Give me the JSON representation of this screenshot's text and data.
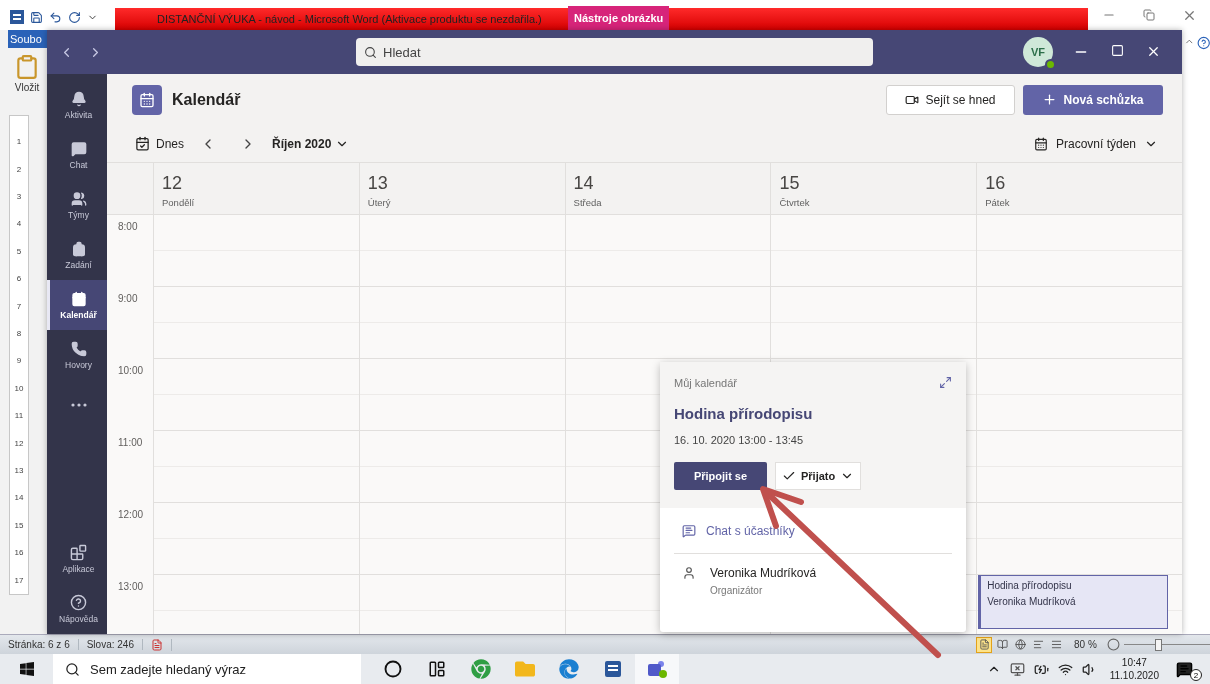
{
  "word": {
    "title": "DISTANČNÍ VÝUKA - návod  -  Microsoft Word (Aktivace produktu se nezdařila.)",
    "context_tab": "Nástroje obrázku",
    "file_tab": "Soubo",
    "paste_label": "Vložit",
    "ruler_numbers": [
      "1",
      "2",
      "3",
      "4",
      "5",
      "6",
      "7",
      "8",
      "9",
      "10",
      "11",
      "12",
      "13",
      "14",
      "15",
      "16",
      "17"
    ],
    "status_bar": {
      "page": "Stránka: 6 z 6",
      "words": "Slova: 246",
      "views": [
        {
          "kind": "print",
          "selected": true
        },
        {
          "kind": "reading",
          "selected": false
        },
        {
          "kind": "web",
          "selected": false
        },
        {
          "kind": "outline",
          "selected": false
        },
        {
          "kind": "draft",
          "selected": false
        }
      ],
      "zoom": "80 %",
      "zoom_slider": {
        "level": 0.4
      }
    }
  },
  "teams": {
    "search": {
      "placeholder": "Hledat"
    },
    "avatar": {
      "initials": "VF"
    },
    "rail": [
      {
        "kind": "activity",
        "label": "Aktivita",
        "selected": false
      },
      {
        "kind": "chat",
        "label": "Chat",
        "selected": false
      },
      {
        "kind": "teams",
        "label": "Týmy",
        "selected": false
      },
      {
        "kind": "assignments",
        "label": "Zadání",
        "selected": false
      },
      {
        "kind": "calendar",
        "label": "Kalendář",
        "selected": true
      },
      {
        "kind": "calls",
        "label": "Hovory",
        "selected": false
      },
      {
        "kind": "more",
        "selected": false
      }
    ],
    "rail_bottom": [
      {
        "kind": "apps",
        "label": "Aplikace"
      },
      {
        "kind": "help",
        "label": "Nápověda"
      }
    ],
    "header": {
      "title": "Kalendář",
      "meet_now": "Sejít se hned",
      "new_meeting": "Nová schůzka"
    },
    "toolbar": {
      "today": "Dnes",
      "month": "Říjen 2020",
      "view": "Pracovní týden"
    },
    "times": [
      "8:00",
      "9:00",
      "10:00",
      "11:00",
      "12:00",
      "13:00"
    ],
    "days": [
      {
        "date": "12",
        "weekday": "Pondělí"
      },
      {
        "date": "13",
        "weekday": "Úterý"
      },
      {
        "date": "14",
        "weekday": "Středa"
      },
      {
        "date": "15",
        "weekday": "Čtvrtek"
      },
      {
        "date": "16",
        "weekday": "Pátek",
        "events": [
          {
            "title": "Hodina přírodopisu",
            "organizer": "Veronika Mudríková"
          }
        ]
      }
    ],
    "popup": {
      "calendar": "Můj kalendář",
      "title": "Hodina přírodopisu",
      "when": "16. 10. 2020 13:00 - 13:45",
      "join": "Připojit se",
      "response": "Přijato",
      "chat": "Chat s účastníky",
      "organizer": {
        "name": "Veronika Mudríková",
        "role": "Organizátor"
      }
    }
  },
  "taskbar": {
    "search": {
      "placeholder": "Sem zadejte hledaný výraz"
    },
    "apps": [
      {
        "kind": "cortana",
        "selected": false
      },
      {
        "kind": "taskview",
        "selected": false
      },
      {
        "kind": "chrome",
        "selected": false
      },
      {
        "kind": "explorer",
        "selected": false
      },
      {
        "kind": "edge",
        "selected": false
      },
      {
        "kind": "word",
        "selected": false
      },
      {
        "kind": "teams",
        "selected": true
      }
    ],
    "time": "10:47",
    "date": "11.10.2020",
    "notifications": "2"
  }
}
